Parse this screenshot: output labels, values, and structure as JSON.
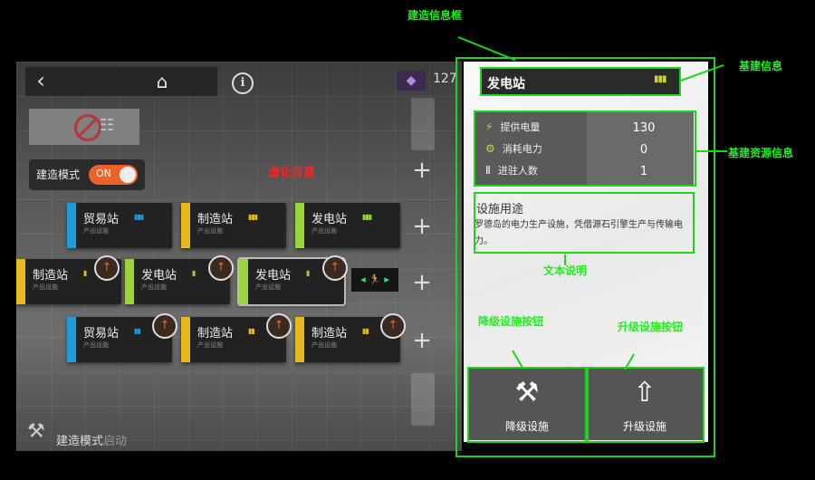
{
  "annotations": {
    "info_frame": "建造信息框",
    "basic_info": "基建信息",
    "resource_info": "基建资源信息",
    "text_desc": "文本说明",
    "downgrade_btn": "降级设施按钮",
    "upgrade_btn": "升级设施按钮",
    "blur_bg": "虚化背景"
  },
  "topbar": {
    "drone_count": "127"
  },
  "mode": {
    "label": "建造模式",
    "toggle": "ON"
  },
  "rooms": [
    {
      "name": "贸易站",
      "sub": "产出设施",
      "color": "#1e9bd8"
    },
    {
      "name": "制造站",
      "sub": "产出设施",
      "color": "#e6b91e"
    },
    {
      "name": "发电站",
      "sub": "产出设施",
      "color": "#9ad33a"
    },
    {
      "name": "制造站",
      "sub": "产出设施",
      "color": "#e6b91e"
    },
    {
      "name": "发电站",
      "sub": "产出设施",
      "color": "#9ad33a"
    },
    {
      "name": "发电站",
      "sub": "产出设施",
      "color": "#9ad33a"
    },
    {
      "name": "贸易站",
      "sub": "产出设施",
      "color": "#1e9bd8"
    },
    {
      "name": "制造站",
      "sub": "产出设施",
      "color": "#e6b91e"
    },
    {
      "name": "制造站",
      "sub": "产出设施",
      "color": "#e6b91e"
    }
  ],
  "footer": {
    "main": "建造模式",
    "dim": "启动"
  },
  "panel": {
    "title": "发电站",
    "resources": [
      {
        "icon": "power-supply-icon",
        "label": "提供电量",
        "value": "130"
      },
      {
        "icon": "power-consume-icon",
        "label": "消耗电力",
        "value": "0"
      },
      {
        "icon": "personnel-icon",
        "label": "进驻人数",
        "value": "1"
      }
    ],
    "desc_title": "设施用途",
    "desc_text": "罗德岛的电力生产设施，凭借源石引擎生产与传输电力。",
    "downgrade_label": "降级设施",
    "upgrade_label": "升级设施"
  }
}
